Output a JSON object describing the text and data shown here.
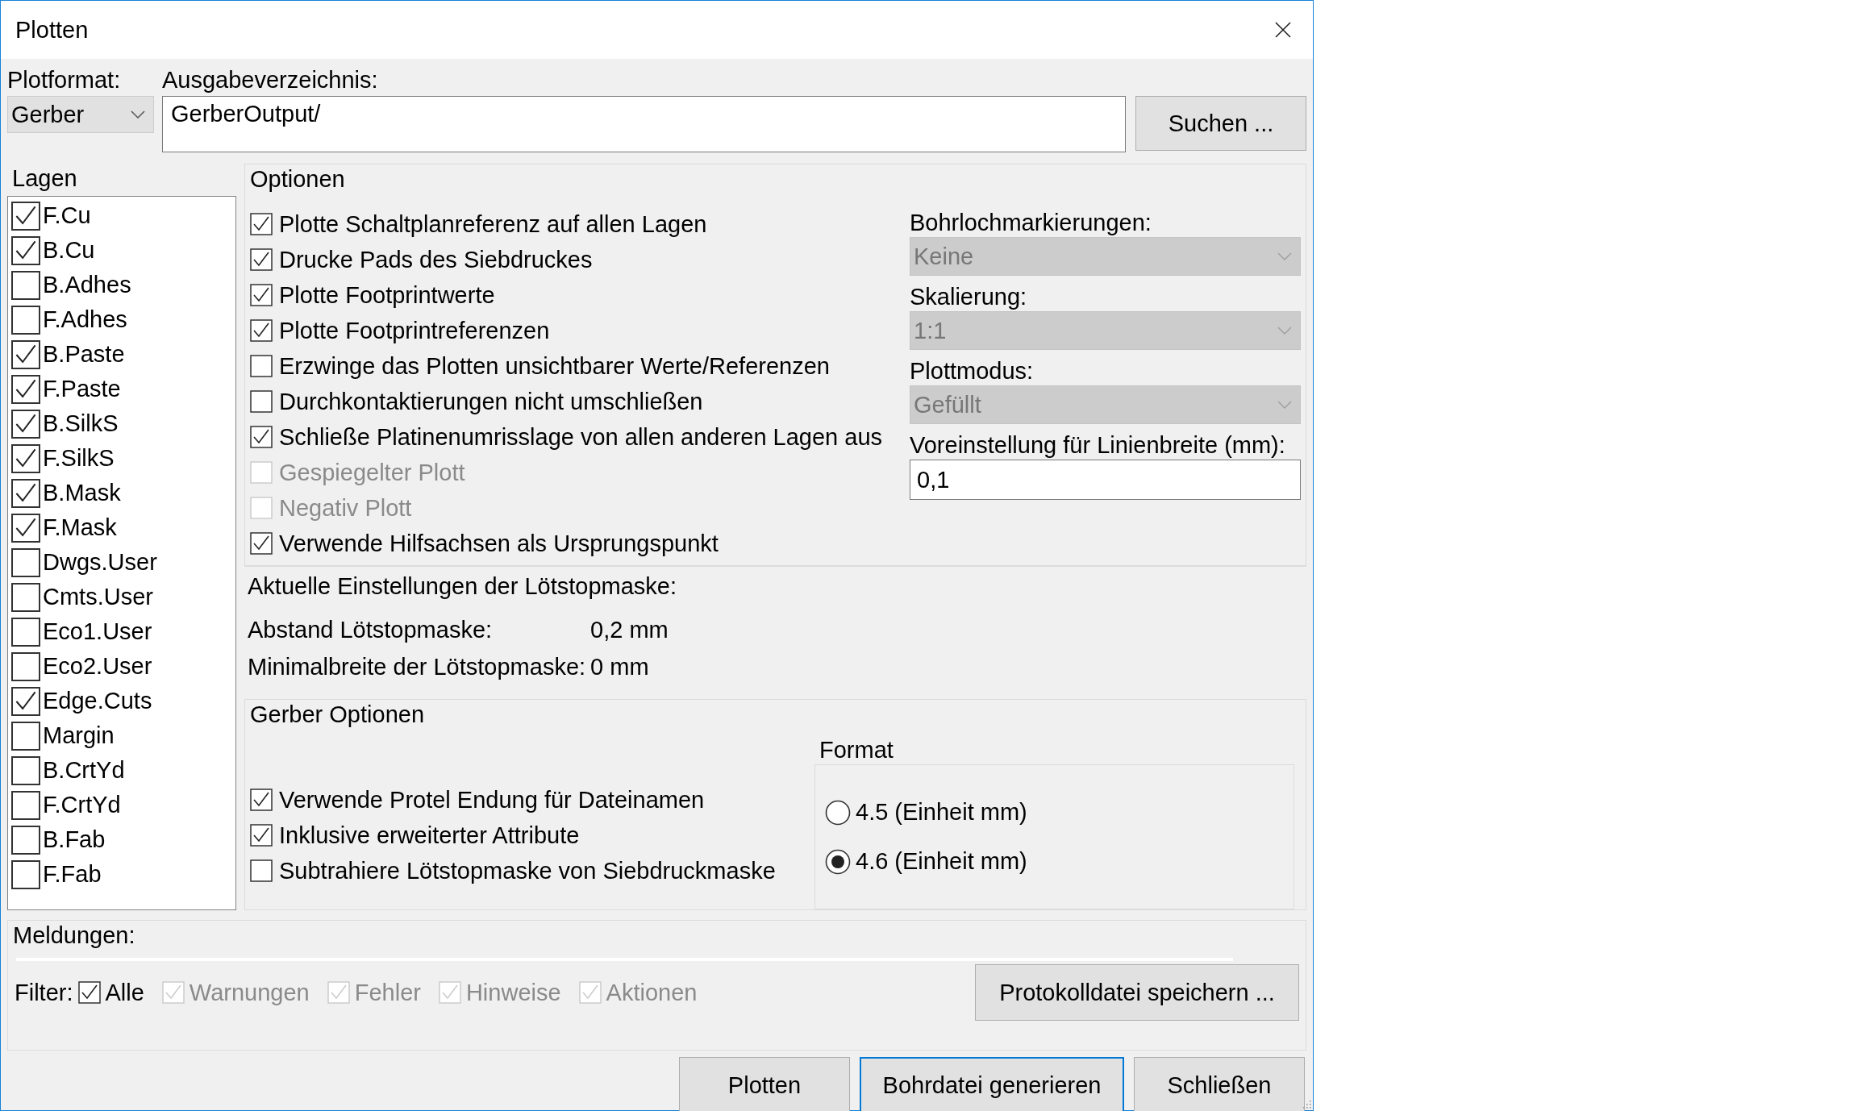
{
  "window": {
    "title": "Plotten"
  },
  "plot_format": {
    "label": "Plotformat:",
    "value": "Gerber"
  },
  "output_dir": {
    "label": "Ausgabeverzeichnis:",
    "value": "GerberOutput/"
  },
  "browse_button": "Suchen ...",
  "layers": {
    "title": "Lagen",
    "items": [
      {
        "name": "F.Cu",
        "checked": true
      },
      {
        "name": "B.Cu",
        "checked": true
      },
      {
        "name": "B.Adhes",
        "checked": false
      },
      {
        "name": "F.Adhes",
        "checked": false
      },
      {
        "name": "B.Paste",
        "checked": true
      },
      {
        "name": "F.Paste",
        "checked": true
      },
      {
        "name": "B.SilkS",
        "checked": true
      },
      {
        "name": "F.SilkS",
        "checked": true
      },
      {
        "name": "B.Mask",
        "checked": true
      },
      {
        "name": "F.Mask",
        "checked": true
      },
      {
        "name": "Dwgs.User",
        "checked": false
      },
      {
        "name": "Cmts.User",
        "checked": false
      },
      {
        "name": "Eco1.User",
        "checked": false
      },
      {
        "name": "Eco2.User",
        "checked": false
      },
      {
        "name": "Edge.Cuts",
        "checked": true
      },
      {
        "name": "Margin",
        "checked": false
      },
      {
        "name": "B.CrtYd",
        "checked": false
      },
      {
        "name": "F.CrtYd",
        "checked": false
      },
      {
        "name": "B.Fab",
        "checked": false
      },
      {
        "name": "F.Fab",
        "checked": false
      }
    ]
  },
  "options": {
    "title": "Optionen",
    "checkboxes": [
      {
        "label": "Plotte Schaltplanreferenz auf allen Lagen",
        "checked": true,
        "disabled": false
      },
      {
        "label": "Drucke Pads des Siebdruckes",
        "checked": true,
        "disabled": false
      },
      {
        "label": "Plotte Footprintwerte",
        "checked": true,
        "disabled": false
      },
      {
        "label": "Plotte Footprintreferenzen",
        "checked": true,
        "disabled": false
      },
      {
        "label": "Erzwinge das Plotten unsichtbarer Werte/Referenzen",
        "checked": false,
        "disabled": false
      },
      {
        "label": "Durchkontaktierungen nicht umschließen",
        "checked": false,
        "disabled": false
      },
      {
        "label": "Schließe Platinenumrisslage von allen anderen Lagen aus",
        "checked": true,
        "disabled": false
      },
      {
        "label": "Gespiegelter Plott",
        "checked": false,
        "disabled": true
      },
      {
        "label": "Negativ Plott",
        "checked": false,
        "disabled": true
      },
      {
        "label": "Verwende Hilfsachsen als Ursprungspunkt",
        "checked": true,
        "disabled": false
      }
    ],
    "selects": [
      {
        "label": "Bohrlochmarkierungen:",
        "value": "Keine",
        "disabled": true
      },
      {
        "label": "Skalierung:",
        "value": "1:1",
        "disabled": true
      },
      {
        "label": "Plottmodus:",
        "value": "Gefüllt",
        "disabled": true
      }
    ],
    "line_width": {
      "label": "Voreinstellung für Linienbreite (mm):",
      "value": "0,1"
    }
  },
  "solder_mask": {
    "title": "Aktuelle Einstellungen der Lötstopmaske:",
    "rows": [
      {
        "label": "Abstand Lötstopmaske:",
        "value": "0,2 mm"
      },
      {
        "label": "Minimalbreite der Lötstopmaske:",
        "value": "0 mm"
      }
    ]
  },
  "gerber_options": {
    "title": "Gerber Optionen",
    "checkboxes": [
      {
        "label": "Verwende Protel Endung für Dateinamen",
        "checked": true,
        "disabled": false
      },
      {
        "label": "Inklusive erweiterter Attribute",
        "checked": true,
        "disabled": false
      },
      {
        "label": "Subtrahiere Lötstopmaske von Siebdruckmaske",
        "checked": false,
        "disabled": false
      }
    ],
    "format": {
      "title": "Format",
      "radios": [
        {
          "label": "4.5 (Einheit mm)",
          "selected": false
        },
        {
          "label": "4.6 (Einheit mm)",
          "selected": true
        }
      ]
    }
  },
  "messages": {
    "title": "Meldungen:",
    "filter_label": "Filter:",
    "filters": [
      {
        "label": "Alle",
        "checked": true,
        "disabled": false
      },
      {
        "label": "Warnungen",
        "checked": true,
        "disabled": true
      },
      {
        "label": "Fehler",
        "checked": true,
        "disabled": true
      },
      {
        "label": "Hinweise",
        "checked": true,
        "disabled": true
      },
      {
        "label": "Aktionen",
        "checked": true,
        "disabled": true
      }
    ],
    "save_button": "Protokolldatei speichern ..."
  },
  "buttons": [
    {
      "label": "Plotten",
      "focused": false
    },
    {
      "label": "Bohrdatei generieren",
      "focused": true
    },
    {
      "label": "Schließen",
      "focused": false
    }
  ]
}
